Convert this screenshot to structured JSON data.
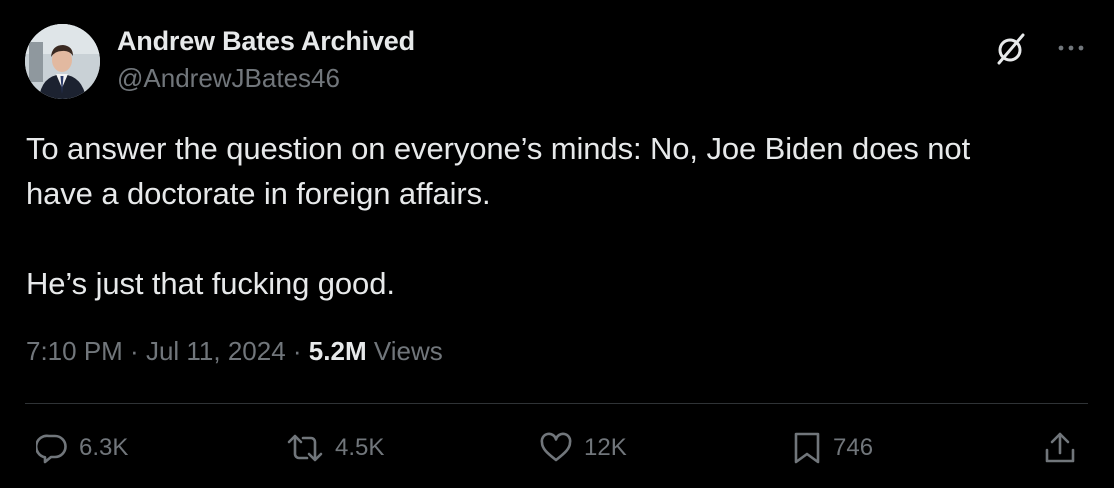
{
  "author": {
    "display_name": "Andrew Bates Archived",
    "handle": "@AndrewJBates46"
  },
  "tweet": {
    "line1": "To answer the question on everyone’s minds: No, Joe Biden does not",
    "line2": "have a doctorate in foreign affairs.",
    "line3": "He’s just that fucking good."
  },
  "meta": {
    "time": "7:10 PM",
    "sep1": " · ",
    "date": "Jul 11, 2024",
    "sep2": " · ",
    "views_count": "5.2M",
    "views_label": " Views"
  },
  "actions": {
    "replies": "6.3K",
    "reposts": "4.5K",
    "likes": "12K",
    "bookmarks": "746"
  },
  "icons": {
    "grok": "grok-icon",
    "more": "more-icon",
    "reply": "reply-icon",
    "repost": "repost-icon",
    "like": "heart-icon",
    "bookmark": "bookmark-icon",
    "share": "share-icon"
  },
  "colors": {
    "background": "#000000",
    "primary_text": "#e7e9ea",
    "secondary_text": "#71767b",
    "divider": "#2f3336"
  }
}
